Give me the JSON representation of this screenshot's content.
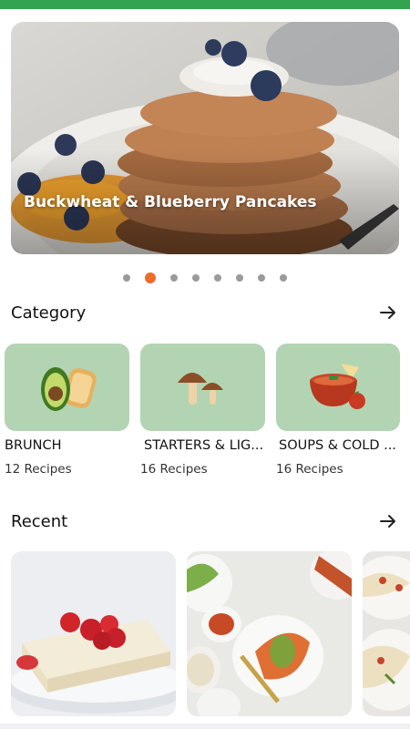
{
  "hero": {
    "title": "Buckwheat & Blueberry Pancakes",
    "active_slide": 2,
    "slide_count": 8
  },
  "category": {
    "title": "Category",
    "arrow_icon": "arrow-right-icon",
    "items": [
      {
        "name": "BRUNCH",
        "count": "12 Recipes",
        "icon": "avocado-toast-icon"
      },
      {
        "name": "STARTERS & LIG...",
        "count": "16 Recipes",
        "icon": "mushroom-icon"
      },
      {
        "name": "SOUPS & COLD ...",
        "count": "16 Recipes",
        "icon": "soup-bowl-icon"
      }
    ]
  },
  "recent": {
    "title": "Recent",
    "arrow_icon": "arrow-right-icon"
  },
  "colors": {
    "status_bar": "#33a352",
    "category_card": "#b3d4b2",
    "active_dot": "#ef6b2c",
    "inactive_dot": "#9a9a9a"
  }
}
